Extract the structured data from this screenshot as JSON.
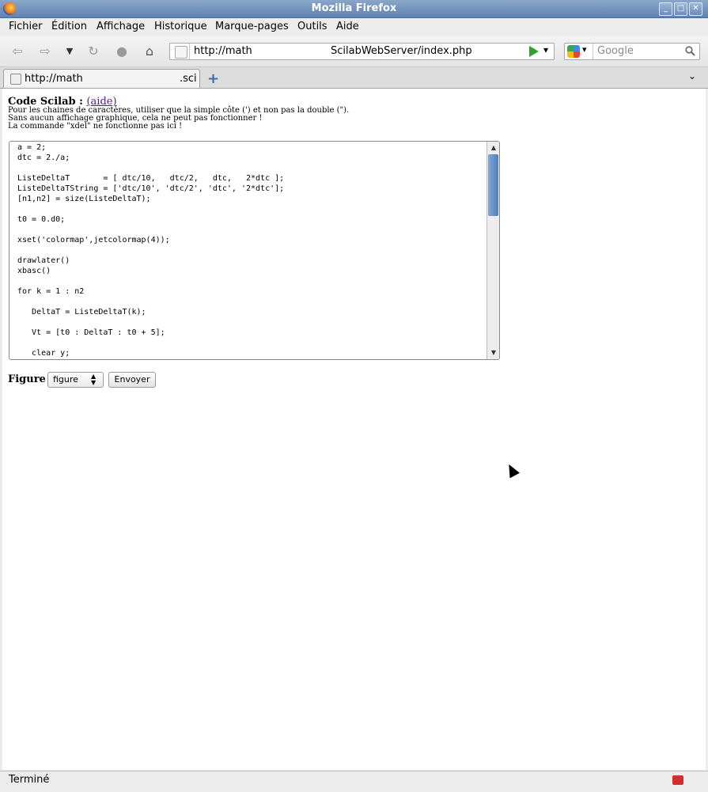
{
  "window": {
    "title": "Mozilla Firefox",
    "minimize_label": "_",
    "maximize_label": "□",
    "close_label": "✕"
  },
  "menu": {
    "items": [
      "Fichier",
      "Édition",
      "Affichage",
      "Historique",
      "Marque-pages",
      "Outils",
      "Aide"
    ]
  },
  "toolbar": {
    "url_part1": "http://math",
    "url_part2": "ScilabWebServer/index.php",
    "search_placeholder": "Google"
  },
  "tab": {
    "title_part1": "http://math",
    "title_part2": ".sci",
    "new_tab_label": "+"
  },
  "page": {
    "heading": "Code Scilab :",
    "help_link": "(aide)",
    "notes": [
      "Pour les chaines de caractères, utiliser que la simple côte (') et non pas la double (\").",
      "Sans aucun affichage graphique, cela ne peut pas fonctionner !",
      "La commande \"xdel\" ne fonctionne pas ici !"
    ],
    "code": "a = 2;\ndtc = 2./a;\n\nListeDeltaT       = [ dtc/10,   dtc/2,   dtc,   2*dtc ];\nListeDeltaTString = ['dtc/10', 'dtc/2', 'dtc', '2*dtc'];\n[n1,n2] = size(ListeDeltaT);\n\nt0 = 0.d0;\n\nxset('colormap',jetcolormap(4));\n\ndrawlater()\nxbasc()\n\nfor k = 1 : n2\n\n   DeltaT = ListeDeltaT(k);\n\n   Vt = [t0 : DeltaT : t0 + 5];\n\n   clear y;",
    "figure_label": "Figure :",
    "figure_select": "figure",
    "send_button": "Envoyer"
  },
  "status": {
    "text": "Terminé"
  }
}
